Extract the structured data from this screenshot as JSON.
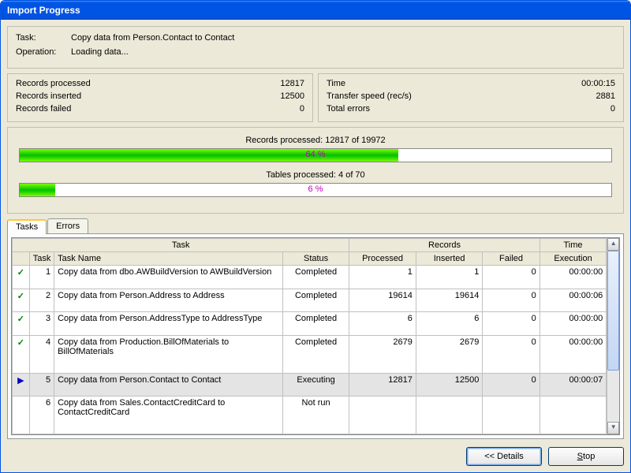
{
  "title": "Import Progress",
  "task_label": "Task:",
  "task_value": "Copy data from Person.Contact to Contact",
  "operation_label": "Operation:",
  "operation_value": "Loading data...",
  "stats_left": [
    {
      "label": "Records processed",
      "value": "12817"
    },
    {
      "label": "Records inserted",
      "value": "12500"
    },
    {
      "label": "Records failed",
      "value": "0"
    }
  ],
  "stats_right": [
    {
      "label": "Time",
      "value": "00:00:15"
    },
    {
      "label": "Transfer speed (rec/s)",
      "value": "2881"
    },
    {
      "label": "Total errors",
      "value": "0"
    }
  ],
  "progress": {
    "records_label": "Records processed:   12817 of 19972",
    "records_pct_text": "64 %",
    "records_pct": 64,
    "tables_label": "Tables processed:   4 of 70",
    "tables_pct_text": "6 %",
    "tables_pct": 6
  },
  "tabs": {
    "tasks": "Tasks",
    "errors": "Errors"
  },
  "grid_headers": {
    "task_group": "Task",
    "records_group": "Records",
    "time_group": "Time",
    "task": "Task",
    "name": "Task Name",
    "status": "Status",
    "processed": "Processed",
    "inserted": "Inserted",
    "failed": "Failed",
    "execution": "Execution"
  },
  "rows": [
    {
      "icon": "check",
      "n": "1",
      "name": "Copy data from dbo.AWBuildVersion to AWBuildVersion",
      "status": "Completed",
      "processed": "1",
      "inserted": "1",
      "failed": "0",
      "exec": "00:00:00"
    },
    {
      "icon": "check",
      "n": "2",
      "name": "Copy data from Person.Address to Address",
      "status": "Completed",
      "processed": "19614",
      "inserted": "19614",
      "failed": "0",
      "exec": "00:00:06"
    },
    {
      "icon": "check",
      "n": "3",
      "name": "Copy data from Person.AddressType to AddressType",
      "status": "Completed",
      "processed": "6",
      "inserted": "6",
      "failed": "0",
      "exec": "00:00:00"
    },
    {
      "icon": "check",
      "n": "4",
      "name": "Copy data from Production.BillOfMaterials to BillOfMaterials",
      "status": "Completed",
      "processed": "2679",
      "inserted": "2679",
      "failed": "0",
      "exec": "00:00:00"
    },
    {
      "icon": "play",
      "n": "5",
      "name": "Copy data from Person.Contact to Contact",
      "status": "Executing",
      "processed": "12817",
      "inserted": "12500",
      "failed": "0",
      "exec": "00:00:07",
      "executing": true
    },
    {
      "icon": "",
      "n": "6",
      "name": "Copy data from Sales.ContactCreditCard to ContactCreditCard",
      "status": "Not run",
      "processed": "",
      "inserted": "",
      "failed": "",
      "exec": ""
    }
  ],
  "buttons": {
    "details": "<< Details",
    "stop": "Stop"
  }
}
